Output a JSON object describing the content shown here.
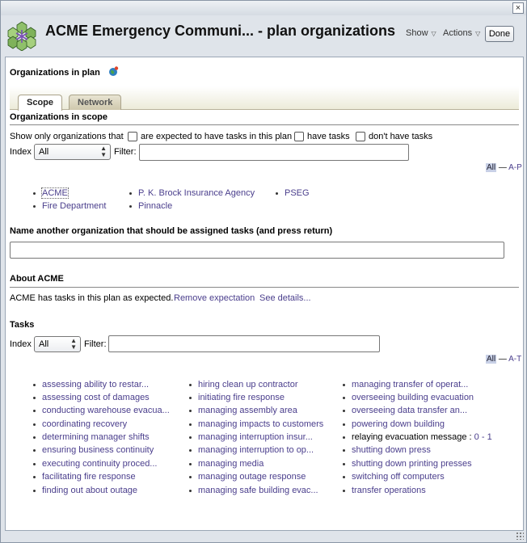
{
  "window": {
    "title": "ACME Emergency Communi... - plan organizations",
    "close_glyph": "×",
    "show_label": "Show",
    "actions_label": "Actions",
    "done_label": "Done"
  },
  "panel": {
    "title": "Organizations in plan",
    "tabs": [
      {
        "label": "Scope",
        "active": true
      },
      {
        "label": "Network",
        "active": false
      }
    ],
    "scope_title": "Organizations in scope",
    "filter_row": {
      "show_only_label": "Show only organizations that",
      "options": [
        {
          "label": "are expected to have tasks in this plan",
          "checked": false
        },
        {
          "label": "have tasks",
          "checked": false
        },
        {
          "label": "don't have tasks",
          "checked": false
        }
      ]
    },
    "org_index": {
      "index_label": "Index",
      "selected": "All",
      "filter_label": "Filter:",
      "filter_value": "",
      "alpha_all": "All",
      "alpha_sep": "—",
      "alpha_range": "A-P"
    },
    "organizations": [
      [
        "ACME",
        "Fire Department"
      ],
      [
        "P. K. Brock Insurance Agency",
        "Pinnacle"
      ],
      [
        "PSEG"
      ]
    ],
    "assign_title": "Name another organization that should be assigned tasks (and press return)",
    "assign_value": "",
    "about": {
      "title": "About ACME",
      "text": "ACME has tasks in this plan as expected.",
      "remove_link": "Remove expectation",
      "details_link": "See details..."
    },
    "tasks": {
      "title": "Tasks",
      "index_label": "Index",
      "selected": "All",
      "filter_label": "Filter:",
      "filter_value": "",
      "alpha_all": "All",
      "alpha_sep": "—",
      "alpha_range": "A-T",
      "columns": [
        [
          "assessing ability to restar...",
          "assessing cost of damages",
          "conducting warehouse evacua...",
          "coordinating recovery",
          "determining manager shifts",
          "ensuring business continuity",
          "executing continuity proced...",
          "facilitating fire response",
          "finding out about outage"
        ],
        [
          "hiring clean up contractor",
          "initiating fire response",
          "managing assembly area",
          "managing impacts to customers",
          "managing interruption insur...",
          "managing interruption to op...",
          "managing media",
          "managing outage response",
          "managing safe building evac..."
        ],
        [
          "managing transfer of operat...",
          "overseeing building evacuation",
          "overseeing data transfer an...",
          "powering down building",
          "relaying evacuation message :",
          "shutting down press",
          "shutting down printing presses",
          "switching off computers",
          "transfer operations"
        ]
      ],
      "relay_links": {
        "first": "0",
        "sep": "-",
        "second": "1"
      }
    }
  },
  "colors": {
    "link": "#4a3e8c",
    "tab_bar": "#ecebd9",
    "window_bg": "#dfe4ea"
  }
}
